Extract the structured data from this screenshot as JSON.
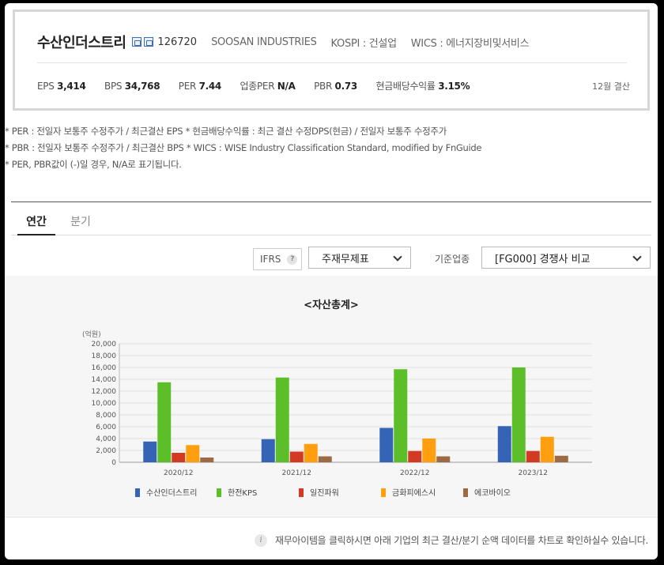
{
  "company": {
    "name": "수산인더스트리",
    "code": "126720",
    "english_name": "SOOSAN INDUSTRIES",
    "market": "KOSPI : 건설업",
    "wics": "WICS : 에너지장비및서비스"
  },
  "metrics": [
    {
      "label": "EPS",
      "value": "3,414"
    },
    {
      "label": "BPS",
      "value": "34,768"
    },
    {
      "label": "PER",
      "value": "7.44"
    },
    {
      "label": "업종PER",
      "value": "N/A"
    },
    {
      "label": "PBR",
      "value": "0.73"
    },
    {
      "label": "현금배당수익률",
      "value": "3.15%"
    }
  ],
  "closing": "12월 결산",
  "notes": [
    "* PER : 전일자 보통주 수정주가 / 최근결산 EPS * 현금배당수익률 : 최근 결산 수정DPS(현금) / 전일자 보통주 수정주가",
    "* PBR : 전일자 보통주 수정주가 / 최근결산 BPS * WICS : WISE Industry Classification Standard, modified by FnGuide",
    "* PER, PBR값이 (-)일 경우, N/A로 표기됩니다."
  ],
  "tabs": [
    {
      "label": "연간",
      "active": true
    },
    {
      "label": "분기",
      "active": false
    }
  ],
  "controls": {
    "ifrs_label": "IFRS",
    "help_glyph": "?",
    "statement_select": "주재무제표",
    "industry_label": "기준업종",
    "industry_select": "[FG000] 경쟁사 비교"
  },
  "chart_data": {
    "type": "bar",
    "title": "<자산총계>",
    "ylabel": "(억원)",
    "ylim": [
      0,
      20000
    ],
    "yticks": [
      "0",
      "2,000",
      "4,000",
      "6,000",
      "8,000",
      "10,000",
      "12,000",
      "14,000",
      "16,000",
      "18,000",
      "20,000"
    ],
    "categories": [
      "2020/12",
      "2021/12",
      "2022/12",
      "2023/12"
    ],
    "series": [
      {
        "name": "수산인더스트리",
        "color": "#3563b5",
        "values": [
          3500,
          3900,
          5800,
          6100
        ]
      },
      {
        "name": "한전KPS",
        "color": "#5cbf2a",
        "values": [
          13500,
          14300,
          15700,
          16000
        ]
      },
      {
        "name": "일진파워",
        "color": "#d23a24",
        "values": [
          1600,
          1800,
          1900,
          1900
        ]
      },
      {
        "name": "금화피에스시",
        "color": "#ff9f10",
        "values": [
          2900,
          3100,
          4000,
          4300
        ]
      },
      {
        "name": "에코바이오",
        "color": "#9c6b45",
        "values": [
          800,
          1000,
          1000,
          1100
        ]
      }
    ],
    "grid": true,
    "legend": "bottom"
  },
  "footer": {
    "icon_glyph": "i",
    "text": "재무아이템을 클릭하시면 아래 기업의 최근 결산/분기 순액 데이터를 차트로 확인하실수 있습니다."
  }
}
